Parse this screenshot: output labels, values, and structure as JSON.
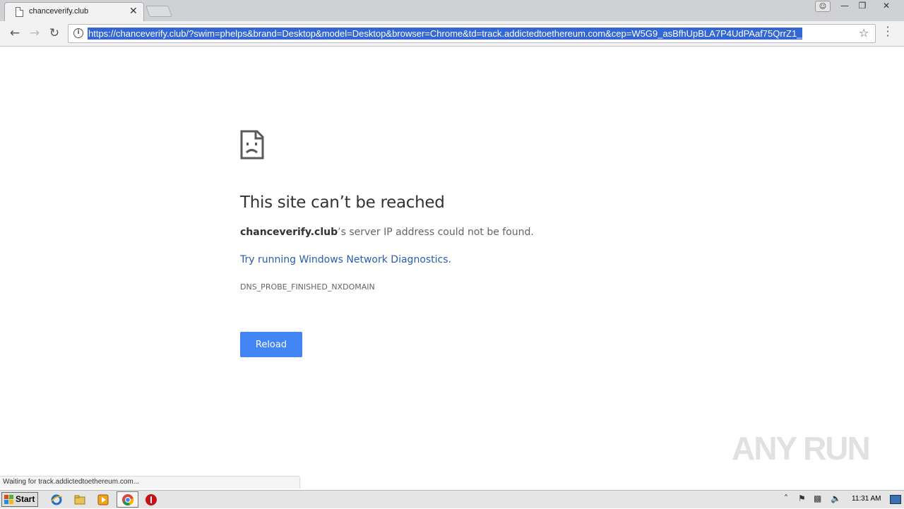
{
  "browser": {
    "tab_title": "chanceverify.club",
    "tab_close": "✕",
    "url": "https://chanceverify.club/?swim=phelps&brand=Desktop&model=Desktop&browser=Chrome&td=track.addictedtoethereum.com&cep=W5G9_asBfhUpBLA7P4UdPAaf75QrrZ1_",
    "status_text": "Waiting for track.addictedtoethereum.com..."
  },
  "error_page": {
    "headline": "This site can’t be reached",
    "domain": "chanceverify.club",
    "detail_suffix": "’s server IP address could not be found.",
    "diagnostics_link": "Try running Windows Network Diagnostics",
    "diagnostics_period": ".",
    "error_code": "DNS_PROBE_FINISHED_NXDOMAIN",
    "reload_label": "Reload"
  },
  "watermark": "ANY RUN",
  "taskbar": {
    "start_label": "Start",
    "clock": "11:31 AM"
  },
  "colors": {
    "accent": "#4285f4",
    "link": "#2a5db0",
    "selection": "#3367d6"
  }
}
